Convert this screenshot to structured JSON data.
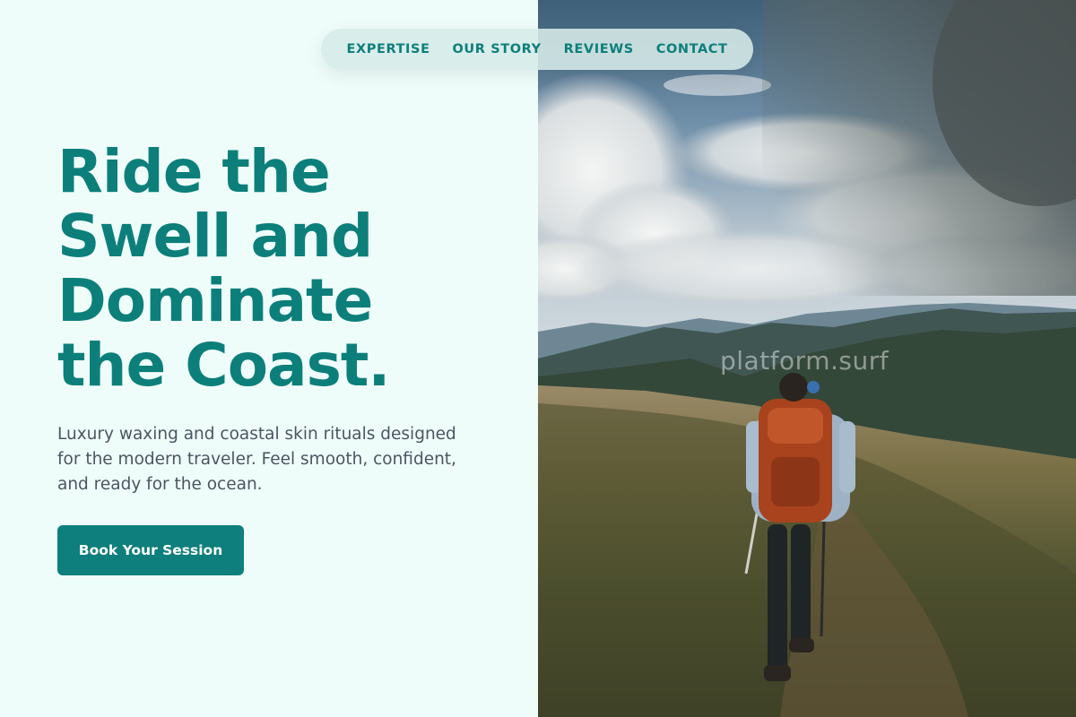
{
  "nav": {
    "items": [
      {
        "label": "EXPERTISE"
      },
      {
        "label": "OUR STORY"
      },
      {
        "label": "REVIEWS"
      },
      {
        "label": "CONTACT"
      }
    ]
  },
  "hero": {
    "title_lines": [
      "Ride the",
      "Swell and",
      "Dominate",
      "the Coast."
    ],
    "subtitle": "Luxury waxing and coastal skin rituals designed for the modern traveler. Feel smooth, confident, and ready for the ocean.",
    "cta_label": "Book Your Session"
  },
  "image": {
    "watermark": "platform.surf",
    "subject": "hiker with orange backpack on mountain trail"
  },
  "colors": {
    "brand_teal": "#0e7f7b",
    "background": "#effdfa",
    "body_text": "#4b5561",
    "button_text": "#ffffff"
  }
}
